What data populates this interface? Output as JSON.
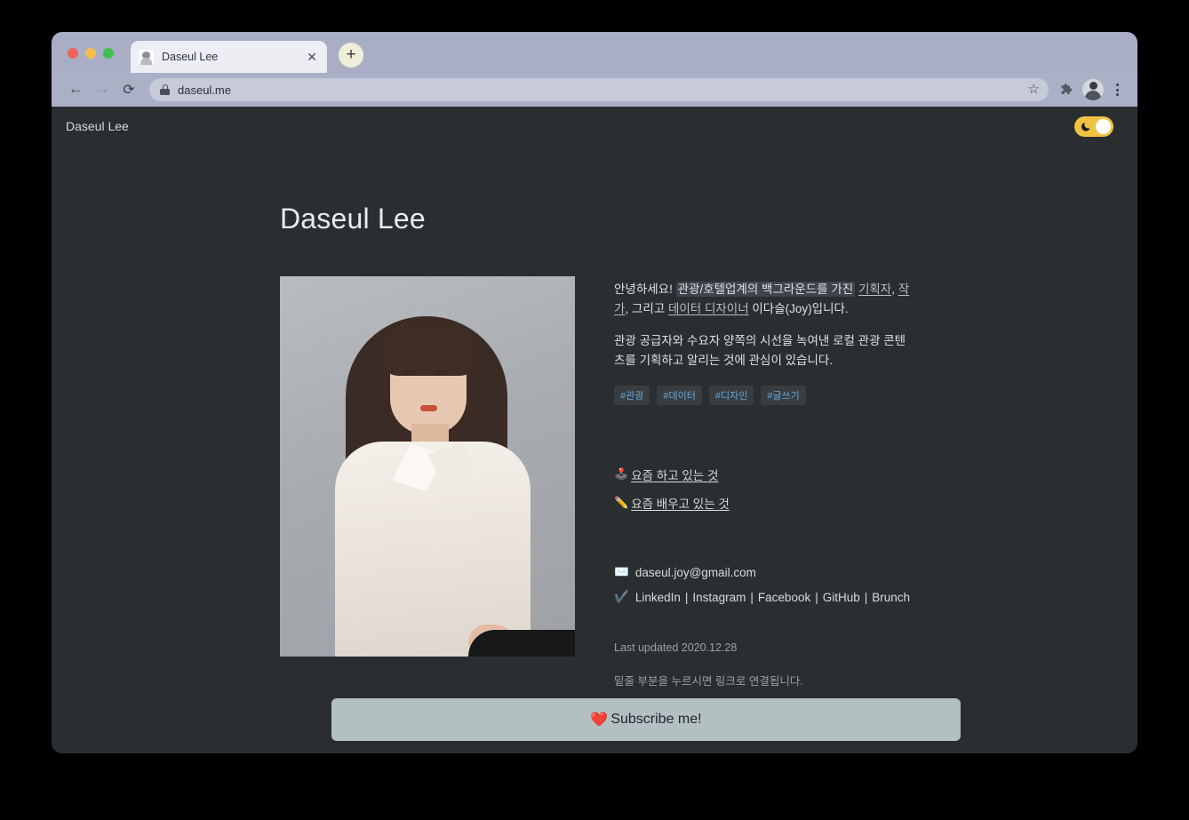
{
  "browser": {
    "tab": {
      "title": "Daseul Lee",
      "favicon": "portrait-favicon",
      "close_label": "✕"
    },
    "new_tab_label": "+",
    "nav": {
      "back": "←",
      "forward": "→",
      "reload": "⟳"
    },
    "omnibox": {
      "url": "daseul.me",
      "lock": "lock-icon",
      "bookmark_star": "☆"
    },
    "extensions_icon": "puzzle-icon",
    "profile_avatar": "user-avatar",
    "menu": "three-dot-menu"
  },
  "site": {
    "brand": "Daseul Lee",
    "theme_toggle": {
      "state": "dark",
      "moon": "🌙",
      "track_color": "#f0c244"
    },
    "title": "Daseul Lee",
    "photo_alt": "Daseul Lee portrait photo",
    "bio": {
      "p1_a": "안녕하세요! ",
      "p1_highlight": "관광/호텔업계의 백그라운드를 가진",
      "p1_link1": "기획자",
      "p1_b": ", ",
      "p1_link2": "작가",
      "p1_c": ", 그리고 ",
      "p1_link3": "데이터 디자이너",
      "p1_d": " 이다슬(Joy)입니다.",
      "p2": "관광 공급자와 수요자 양쪽의 시선을 녹여낸 로컬 관광 콘텐츠를 기획하고 알리는 것에 관심이 있습니다."
    },
    "tags": [
      "#관광",
      "#데이터",
      "#디자인",
      "#글쓰기"
    ],
    "links": [
      {
        "emoji": "🕹️",
        "icon_name": "joystick-icon",
        "label": "요즘 하고 있는 것"
      },
      {
        "emoji": "✏️",
        "icon_name": "pencil-icon",
        "label": "요즘 배우고 있는 것"
      }
    ],
    "contact": {
      "email_emoji": "✉️",
      "email": "daseul.joy@gmail.com",
      "socials_emoji": "✔️",
      "separator": "|",
      "socials": [
        "LinkedIn",
        "Instagram",
        "Facebook",
        "GitHub",
        "Brunch"
      ]
    },
    "footer": {
      "last_updated": "Last updated 2020.12.28",
      "hint": "밑줄 부분을 누르시면 링크로 연결됩니다."
    },
    "subscribe": {
      "emoji": "❤️",
      "label": "Subscribe me!"
    }
  },
  "colors": {
    "page_bg": "#2a2e31",
    "tabstrip": "#a9aec4",
    "toolbar": "#aab0c6",
    "accent_yellow": "#f0c244",
    "tag_text": "#6aa7d8",
    "subscribe_bg": "#b3c0c2"
  }
}
